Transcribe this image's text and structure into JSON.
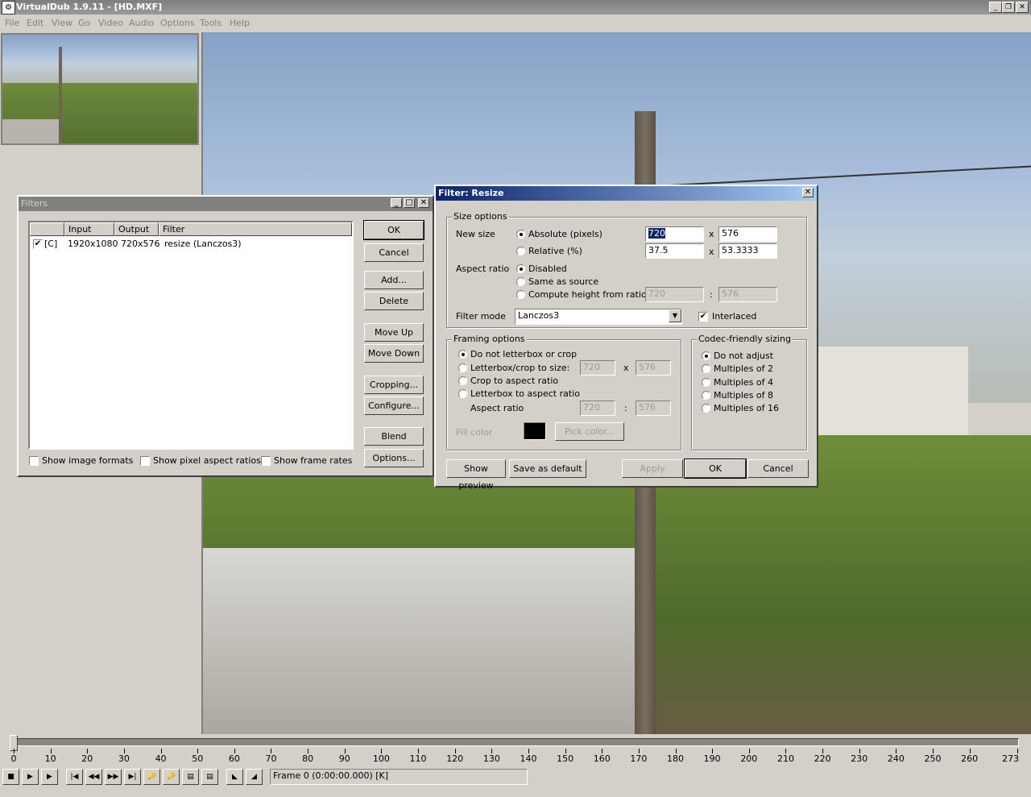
{
  "window": {
    "title": "VirtualDub 1.9.11 - [HD.MXF]"
  },
  "menu": [
    "File",
    "Edit",
    "View",
    "Go",
    "Video",
    "Audio",
    "Options",
    "Tools",
    "Help"
  ],
  "filters_dialog": {
    "title": "Filters",
    "columns": [
      "",
      "Input",
      "Output",
      "Filter"
    ],
    "rows": [
      {
        "checked": true,
        "tag": "[C]",
        "input": "1920x1080",
        "output": "720x576",
        "filter": "resize (Lanczos3)"
      }
    ],
    "buttons": {
      "ok": "OK",
      "cancel": "Cancel",
      "add": "Add...",
      "delete": "Delete",
      "move_up": "Move Up",
      "move_down": "Move Down",
      "cropping": "Cropping...",
      "configure": "Configure...",
      "blend": "Blend",
      "options": "Options..."
    },
    "checkboxes": {
      "image_formats": "Show image formats",
      "pixel_aspect": "Show pixel aspect ratios",
      "frame_rates": "Show frame rates"
    }
  },
  "resize_dialog": {
    "title": "Filter: Resize",
    "size_options": {
      "group": "Size options",
      "new_size": "New size",
      "absolute": "Absolute (pixels)",
      "relative": "Relative (%)",
      "abs_w": "720",
      "abs_h": "576",
      "rel_w": "37.5",
      "rel_h": "53.3333",
      "x": "x",
      "aspect_ratio": "Aspect ratio",
      "disabled": "Disabled",
      "same_as_source": "Same as source",
      "compute_height": "Compute height from ratio:",
      "ratio_w": "720",
      "ratio_h": "576",
      "colon": ":",
      "filter_mode": "Filter mode",
      "filter_mode_value": "Lanczos3",
      "interlaced": "Interlaced"
    },
    "framing": {
      "group": "Framing options",
      "none": "Do not letterbox or crop",
      "letterbox_size": "Letterbox/crop to size:",
      "lb_w": "720",
      "lb_h": "576",
      "crop_aspect": "Crop to aspect ratio",
      "letterbox_aspect": "Letterbox to aspect ratio",
      "aspect_ratio": "Aspect ratio",
      "ar_w": "720",
      "ar_h": "576",
      "fill_color": "Fill color",
      "pick_color": "Pick color..."
    },
    "codec": {
      "group": "Codec-friendly sizing",
      "options": [
        "Do not adjust",
        "Multiples of 2",
        "Multiples of 4",
        "Multiples of 8",
        "Multiples of 16"
      ]
    },
    "buttons": {
      "show_preview": "Show preview",
      "save_default": "Save as default",
      "apply": "Apply",
      "ok": "OK",
      "cancel": "Cancel"
    }
  },
  "timeline": {
    "ticks": [
      "0",
      "10",
      "20",
      "30",
      "40",
      "50",
      "60",
      "70",
      "80",
      "90",
      "100",
      "110",
      "120",
      "130",
      "140",
      "150",
      "160",
      "170",
      "180",
      "190",
      "200",
      "210",
      "220",
      "230",
      "240",
      "250",
      "260",
      "273"
    ],
    "status": "Frame 0 (0:00:00.000) [K]"
  },
  "colors": {
    "active_title": "#0a246a",
    "active_title_end": "#a6caf0",
    "inactive_title": "#808080"
  }
}
